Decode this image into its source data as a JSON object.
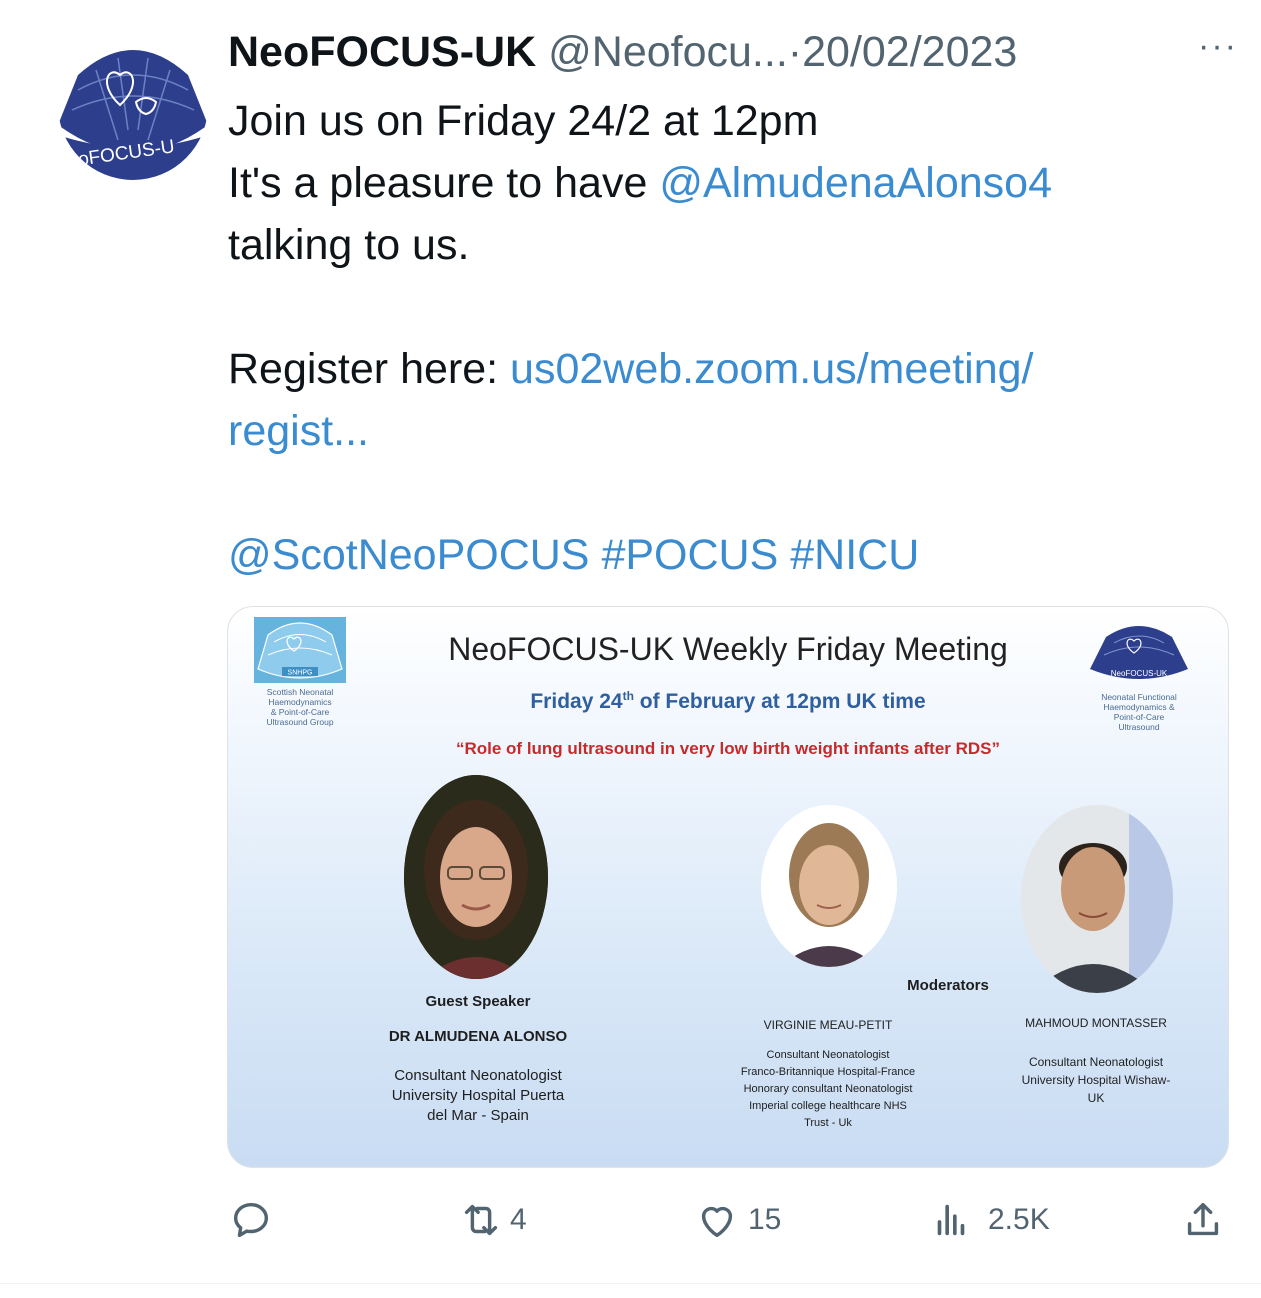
{
  "tweet": {
    "author_name": "NeoFOCUS-UK",
    "handle": "@Neofocu...",
    "separator": "·",
    "date": "20/02/2023",
    "more": "···",
    "line1": "Join us on Friday 24/2 at 12pm",
    "line2_prefix": "It's a pleasure to have ",
    "line2_mention": "@AlmudenaAlonso4",
    "line3": "talking to us.",
    "line5_prefix": "Register here: ",
    "line5_link": "us02web.zoom.us/meeting/",
    "line6_link": "regist...",
    "tags": [
      "@ScotNeoPOCUS",
      "#POCUS",
      "#NICU"
    ]
  },
  "avatar": {
    "logo_text": "eoFOCUS-U"
  },
  "poster": {
    "title": "NeoFOCUS-UK Weekly Friday Meeting",
    "date_prefix": "Friday 24",
    "date_sup": "th",
    "date_suffix": " of February at 12pm UK time",
    "topic": "“Role of lung ultrasound in very low birth weight infants after RDS”",
    "left_logo": {
      "badge": "SNHPG",
      "caption": [
        "Scottish Neonatal",
        "Haemodynamics",
        "& Point-of-Care",
        "Ultrasound Group"
      ]
    },
    "right_logo": {
      "badge": "NeoFOCUS-UK",
      "caption": [
        "Neonatal Functional",
        "Haemodynamics &",
        "Point-of-Care",
        "Ultrasound"
      ]
    },
    "guest_label": "Guest Speaker",
    "moderators_label": "Moderators",
    "guest": {
      "name": "DR ALMUDENA ALONSO",
      "lines": [
        "Consultant Neonatologist",
        "University Hospital Puerta",
        "del Mar - Spain"
      ]
    },
    "moderator1": {
      "name": "VIRGINIE MEAU-PETIT",
      "lines": [
        "Consultant Neonatologist",
        "Franco-Britannique Hospital-France",
        "Honorary consultant Neonatologist",
        "Imperial college healthcare NHS",
        "Trust - Uk"
      ]
    },
    "moderator2": {
      "name": "MAHMOUD MONTASSER",
      "lines": [
        "Consultant Neonatologist",
        "University Hospital Wishaw-",
        "UK"
      ]
    }
  },
  "actions": {
    "reply_icon": "reply-icon",
    "retweet_icon": "retweet-icon",
    "retweets": "4",
    "like_icon": "heart-icon",
    "likes": "15",
    "views_icon": "views-icon",
    "views": "2.5K",
    "share_icon": "share-icon"
  },
  "colors": {
    "link": "#3a8bd0",
    "muted": "#536471",
    "text": "#0f1419",
    "logo_blue": "#2d3f8c",
    "poster_date": "#2f5f9e",
    "poster_topic": "#c72a2a"
  }
}
